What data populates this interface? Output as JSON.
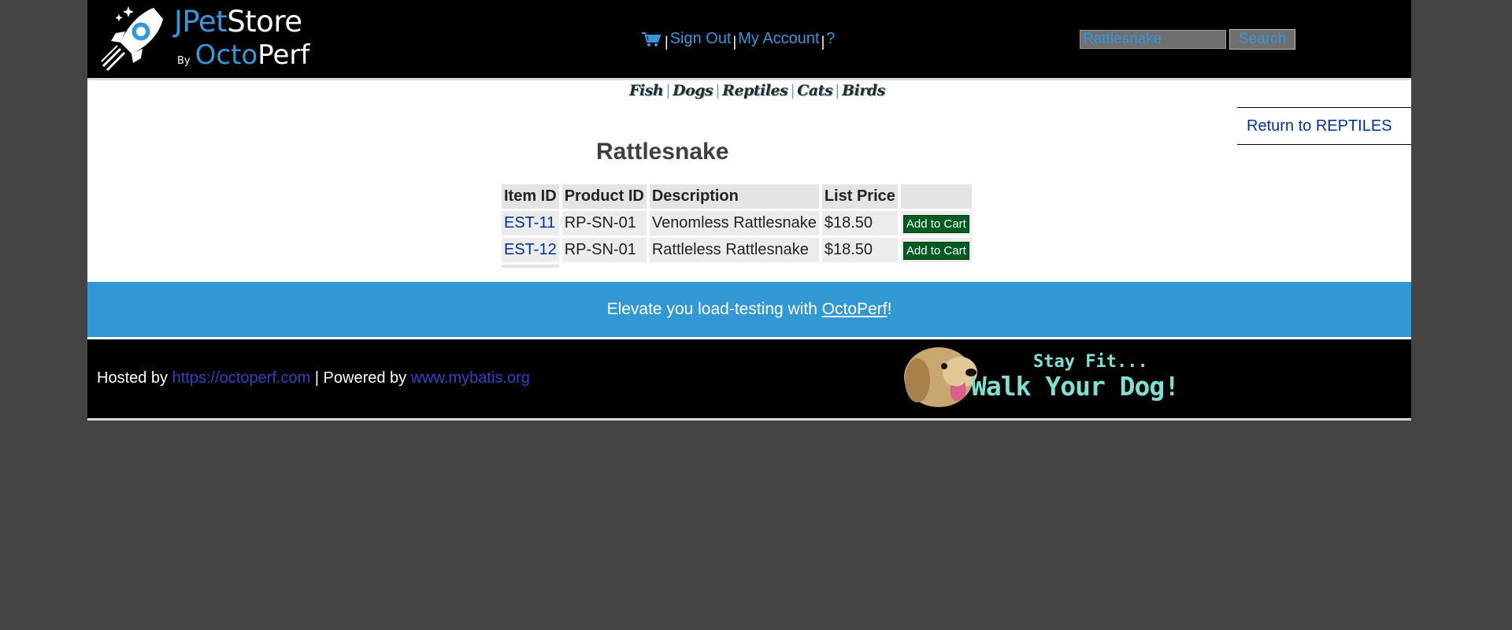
{
  "header": {
    "brand": {
      "jpet": "JPet",
      "store": "Store",
      "by": "By",
      "octo": "Octo",
      "perf": "Perf"
    },
    "menu": {
      "sign_out": "Sign Out",
      "my_account": "My Account",
      "help": "?",
      "separator": "|"
    },
    "search": {
      "value": "Rattlesnake",
      "button": "Search"
    }
  },
  "quicklinks": [
    "Fish",
    "Dogs",
    "Reptiles",
    "Cats",
    "Birds"
  ],
  "quicklink_separator": "|",
  "back_link": "Return to REPTILES",
  "product": {
    "name": "Rattlesnake",
    "columns": [
      "Item ID",
      "Product ID",
      "Description",
      "List Price",
      ""
    ],
    "items": [
      {
        "item_id": "EST-11",
        "product_id": "RP-SN-01",
        "description": "Venomless Rattlesnake",
        "price": "$18.50",
        "action": "Add to Cart"
      },
      {
        "item_id": "EST-12",
        "product_id": "RP-SN-01",
        "description": "Rattleless Rattlesnake",
        "price": "$18.50",
        "action": "Add to Cart"
      }
    ]
  },
  "promo": {
    "prefix": "Elevate you load-testing with ",
    "link": "OctoPerf",
    "suffix": "!"
  },
  "footer": {
    "hosted_by": "Hosted by ",
    "hosted_link": "https://octoperf.com",
    "powered_by": " | Powered by ",
    "powered_link": "www.mybatis.org",
    "banner_line1": "Stay Fit...",
    "banner_line2": "Walk Your Dog!"
  },
  "colors": {
    "accent": "#3598dc",
    "promo": "#3198d4",
    "cart_button": "#005c22",
    "link": "#003399",
    "page_bg": "#444444"
  },
  "icons": {
    "logo": "rocket-icon",
    "cart": "cart-icon"
  }
}
